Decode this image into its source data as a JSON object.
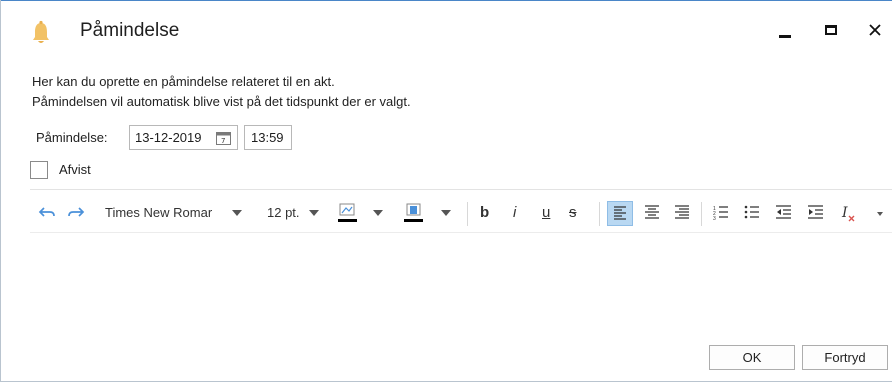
{
  "window": {
    "title": "Påmindelse",
    "controls": {
      "minimize": "minimize",
      "maximize": "maximize",
      "close": "close"
    }
  },
  "description": {
    "line1": "Her kan du oprette en påmindelse relateret til en akt.",
    "line2": "Påmindelsen vil automatisk blive vist på det tidspunkt der er valgt."
  },
  "reminder": {
    "label": "Påmindelse:",
    "date": "13-12-2019",
    "time": "13:59"
  },
  "rejected": {
    "label": "Afvist",
    "checked": false
  },
  "toolbar": {
    "font_name": "Times New Romar",
    "font_size": "12 pt.",
    "bold": "b",
    "italic": "i",
    "underline": "u",
    "strikethrough": "s",
    "font_color": "#000000",
    "highlight_color": "#000000",
    "active_align": "align-left"
  },
  "buttons": {
    "ok": "OK",
    "cancel": "Fortryd"
  }
}
